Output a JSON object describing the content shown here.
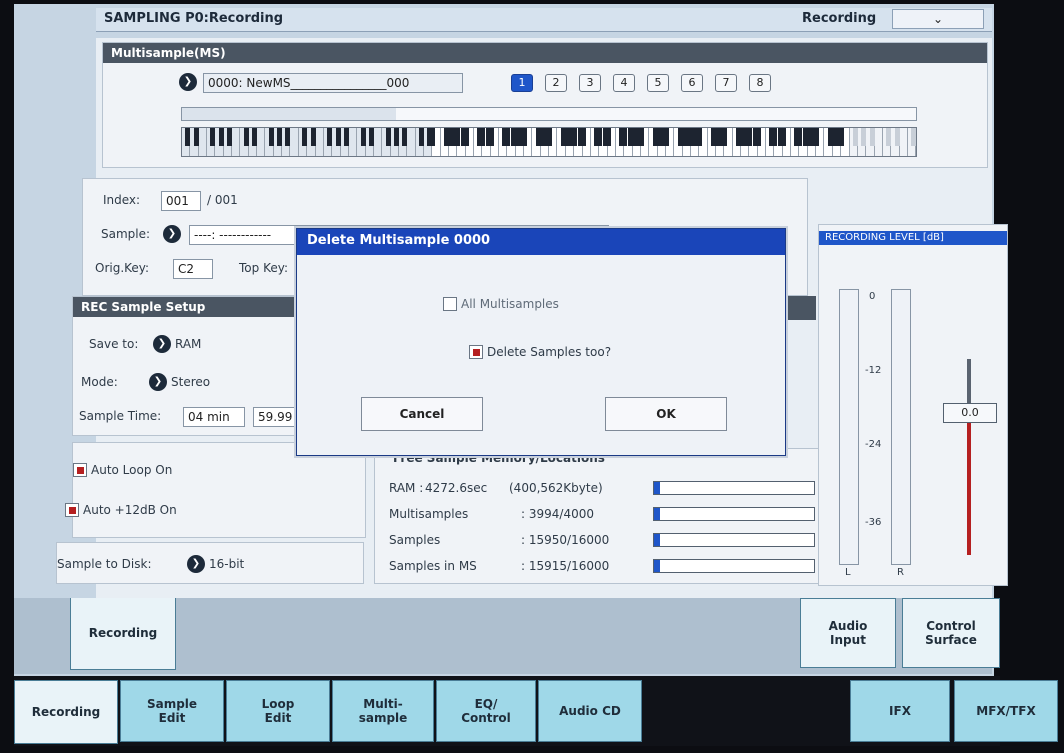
{
  "header": {
    "title": "SAMPLING P0:Recording",
    "mode_label": "Recording",
    "dropdown_icon": "chevron-down-icon"
  },
  "multisample": {
    "section_label": "Multisample(MS)",
    "name_value": "0000: NewMS________________000",
    "bank_buttons": [
      "1",
      "2",
      "3",
      "4",
      "5",
      "6",
      "7",
      "8"
    ],
    "active_bank": "1"
  },
  "sample": {
    "index_label": "Index:",
    "index_value": "001",
    "index_total": "/ 001",
    "sample_label": "Sample:",
    "sample_value": "----: ------------",
    "orig_key_label": "Orig.Key:",
    "orig_key_value": "C2",
    "top_key_label": "Top Key:"
  },
  "rec_setup": {
    "section_label": "REC Sample Setup",
    "save_to_label": "Save to:",
    "save_to_value": "RAM",
    "mode_label": "Mode:",
    "mode_value": "Stereo",
    "sample_time_label": "Sample Time:",
    "sample_time_min": "04 min",
    "sample_time_sec": "59.99",
    "auto_loop_label": "Auto Loop On",
    "auto_12db_label": "Auto +12dB On",
    "sample_to_disk_label": "Sample to Disk:",
    "sample_to_disk_value": "16-bit"
  },
  "memory": {
    "section_label": "Free Sample Memory/Locations",
    "rows": [
      {
        "label": "RAM :",
        "value": "4272.6sec",
        "extra": "(400,562Kbyte)",
        "fill": 0.02
      },
      {
        "label": "Multisamples",
        "value": ": 3994/4000",
        "extra": "",
        "fill": 0.0
      },
      {
        "label": "Samples",
        "value": ": 15950/16000",
        "extra": "",
        "fill": 0.0
      },
      {
        "label": "Samples in MS",
        "value": ": 15915/16000",
        "extra": "",
        "fill": 0.0
      }
    ]
  },
  "recording_level": {
    "title": "RECORDING LEVEL [dB]",
    "scale": [
      "0",
      "-12",
      "-24",
      "-36"
    ],
    "left_label": "L",
    "right_label": "R",
    "slider_value": "0.0"
  },
  "dialog": {
    "title": "Delete Multisample 0000",
    "all_multisamples_label": "All Multisamples",
    "delete_samples_label": "Delete Samples too?",
    "cancel_label": "Cancel",
    "ok_label": "OK"
  },
  "sub_tabs": {
    "left": "Recording",
    "audio_input": "Audio\nInput",
    "control_surface": "Control\nSurface"
  },
  "bottom_tabs": [
    "Recording",
    "Sample\nEdit",
    "Loop\nEdit",
    "Multi-\nsample",
    "EQ/\nControl",
    "Audio CD",
    "IFX",
    "MFX/TFX"
  ]
}
